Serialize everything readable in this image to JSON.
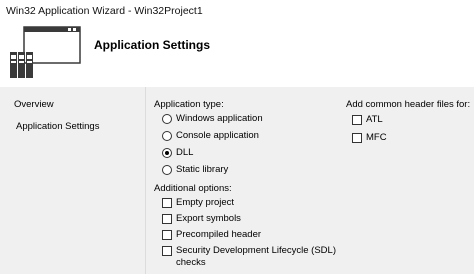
{
  "window": {
    "title": "Win32 Application Wizard - Win32Project1"
  },
  "header": {
    "icon": "application-wizard-icon",
    "title": "Application Settings"
  },
  "nav": {
    "items": [
      {
        "label": "Overview"
      },
      {
        "label": "Application Settings"
      }
    ]
  },
  "application_type": {
    "label": "Application type:",
    "options": [
      {
        "label": "Windows application",
        "selected": false
      },
      {
        "label": "Console application",
        "selected": false
      },
      {
        "label": "DLL",
        "selected": true
      },
      {
        "label": "Static library",
        "selected": false
      }
    ]
  },
  "additional_options": {
    "label": "Additional options:",
    "options": [
      {
        "label": "Empty project",
        "checked": false
      },
      {
        "label": "Export symbols",
        "checked": false
      },
      {
        "label": "Precompiled header",
        "checked": false
      },
      {
        "label": "Security Development Lifecycle (SDL)",
        "label2": "checks",
        "checked": false
      }
    ]
  },
  "common_headers": {
    "label": "Add common header files for:",
    "options": [
      {
        "label": "ATL",
        "checked": false
      },
      {
        "label": "MFC",
        "checked": false
      }
    ]
  }
}
